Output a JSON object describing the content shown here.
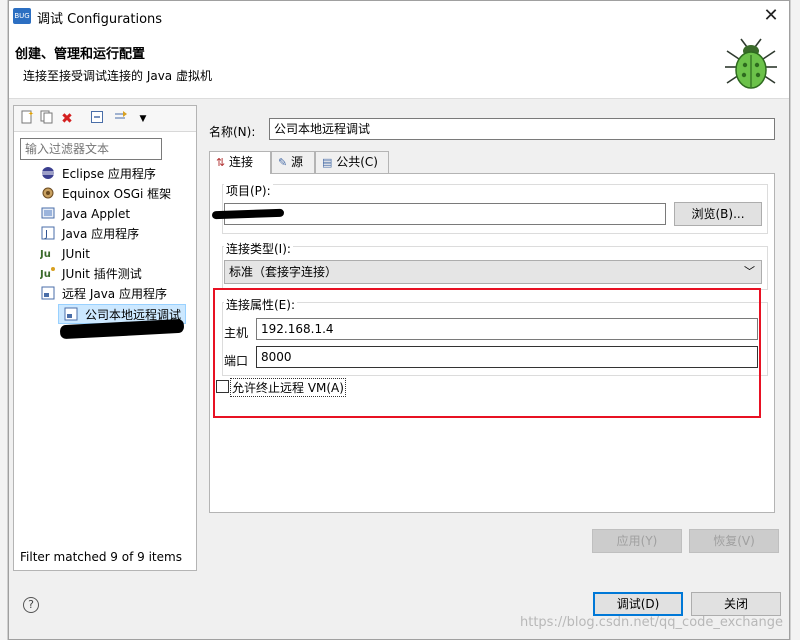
{
  "window": {
    "title": "调试 Configurations",
    "icon_label": "BUG",
    "close_glyph": "✕"
  },
  "header": {
    "title": "创建、管理和运行配置",
    "subtitle": "连接至接受调试连接的 Java 虚拟机",
    "icon": "bug-icon"
  },
  "left": {
    "toolbar_icons": [
      "new-config-icon",
      "duplicate-icon",
      "delete-icon",
      "collapse-all-icon",
      "filter-icon",
      "dropdown-icon"
    ],
    "filter_placeholder": "输入过滤器文本",
    "tree": [
      {
        "label": "Eclipse 应用程序",
        "icon": "eclipse-icon",
        "level": 0
      },
      {
        "label": "Equinox OSGi 框架",
        "icon": "osgi-icon",
        "level": 0
      },
      {
        "label": "Java Applet",
        "icon": "applet-icon",
        "level": 0
      },
      {
        "label": "Java 应用程序",
        "icon": "java-app-icon",
        "level": 0
      },
      {
        "label": "JUnit",
        "icon": "junit-icon",
        "level": 0
      },
      {
        "label": "JUnit 插件测试",
        "icon": "junit-plugin-icon",
        "level": 0
      },
      {
        "label": "远程 Java 应用程序",
        "icon": "remote-java-icon",
        "level": 0
      },
      {
        "label": "公司本地远程调试",
        "icon": "remote-config-icon",
        "level": 1,
        "selected": true
      }
    ],
    "status": "Filter matched 9 of 9 items"
  },
  "right": {
    "name_label": "名称(N):",
    "name_value": "公司本地远程调试",
    "tabs": [
      {
        "label": "连接",
        "icon": "connect-icon",
        "active": true
      },
      {
        "label": "源",
        "icon": "source-icon",
        "active": false
      },
      {
        "label": "公共(C)",
        "icon": "common-icon",
        "active": false
      }
    ],
    "project_label": "项目(P):",
    "browse_label": "浏览(B)...",
    "conn_type_label": "连接类型(I):",
    "conn_type_value": "标准（套接字连接）",
    "conn_props_label": "连接属性(E):",
    "host_label": "主机",
    "host_value": "192.168.1.4",
    "port_label": "端口",
    "port_value": "8000",
    "allow_terminate_label": "允许终止远程 VM(A)",
    "allow_terminate_checked": false,
    "apply_label": "应用(Y)",
    "revert_label": "恢复(V)"
  },
  "footer": {
    "debug_label": "调试(D)",
    "close_label": "关闭",
    "watermark": "https://blog.csdn.net/qq_code_exchange"
  },
  "colors": {
    "highlight_box": "#e81123",
    "selection": "#cce8ff",
    "primary_border": "#0078d7"
  }
}
